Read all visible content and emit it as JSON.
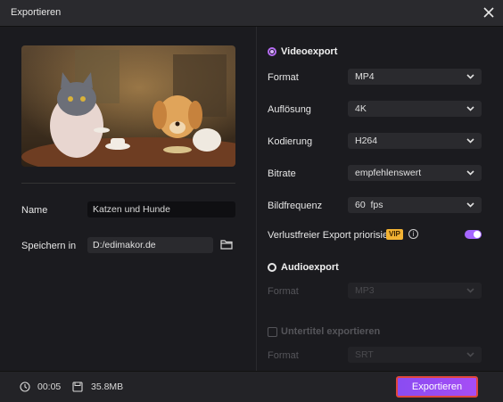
{
  "window": {
    "title": "Exportieren"
  },
  "colors": {
    "accent": "#a566ff",
    "vip_badge": "#f2b233",
    "highlight_border": "#e0463e"
  },
  "left": {
    "name_label": "Name",
    "name_value": "Katzen und Hunde",
    "save_label": "Speichern in",
    "save_path": "D:/edimakor.de",
    "preview_icon": "cat-dog-tea-party-thumbnail"
  },
  "video": {
    "section_title": "Videoexport",
    "selected": true,
    "rows": [
      {
        "label": "Format",
        "value": "MP4"
      },
      {
        "label": "Auflösung",
        "value": "4K"
      },
      {
        "label": "Kodierung",
        "value": "H264"
      },
      {
        "label": "Bitrate",
        "value": "empfehlenswert"
      },
      {
        "label": "Bildfrequenz",
        "value": "60  fps"
      }
    ],
    "lossless_label": "Verlustfreier Export priorisiert",
    "vip_badge": "VIP",
    "lossless_enabled": true
  },
  "audio": {
    "section_title": "Audioexport",
    "selected": false,
    "format_label": "Format",
    "format_value": "MP3"
  },
  "subtitle": {
    "label": "Untertitel exportieren",
    "checked": false,
    "format_label": "Format",
    "format_value": "SRT"
  },
  "footer": {
    "duration": "00:05",
    "size": "35.8MB",
    "export_button": "Exportieren"
  }
}
